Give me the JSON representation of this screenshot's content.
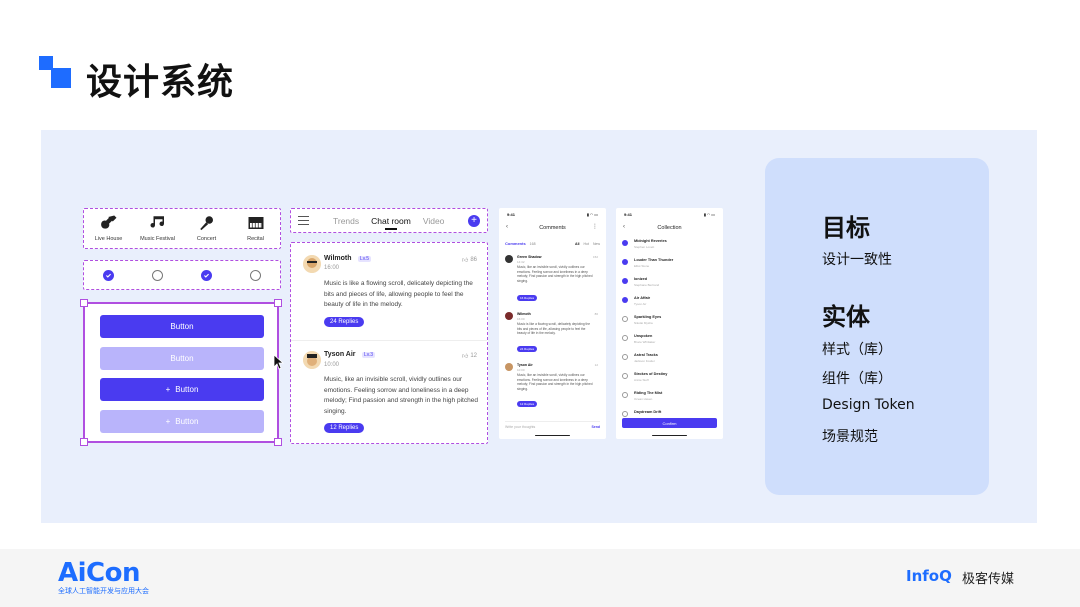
{
  "header": {
    "title": "设计系统"
  },
  "icon_nav": {
    "items": [
      {
        "label": "Live House",
        "icon": "guitar-icon"
      },
      {
        "label": "Music Festival",
        "icon": "music-note-icon"
      },
      {
        "label": "Concert",
        "icon": "microphone-icon"
      },
      {
        "label": "Recital",
        "icon": "piano-icon"
      }
    ]
  },
  "checkbox_row": {
    "states": [
      true,
      false,
      true,
      false
    ]
  },
  "buttons": {
    "primary_label": "Button",
    "disabled_label": "Button",
    "primary_icon_label": "Button",
    "disabled_icon_label": "Button",
    "plus_glyph": "+"
  },
  "tabs_bar": {
    "tabs": [
      "Trends",
      "Chat room",
      "Video"
    ],
    "active_tab": "Chat room",
    "plus": "+"
  },
  "comments": [
    {
      "name": "Wilmoth",
      "level": "Lv.5",
      "time": "16:00",
      "likes": "86",
      "text": "Music is like a flowing scroll, delicately depicting the bits and pieces of life, allowing people to feel the beauty of life in the melody.",
      "replies": "24 Replies"
    },
    {
      "name": "Tyson Air",
      "level": "Lv.3",
      "time": "10:00",
      "likes": "12",
      "text": "Music, like an invisible scroll, vividly outlines our emotions. Feeling sorrow and loneliness in a deep melody; Find passion and strength in the high pitched singing.",
      "replies": "12 Replies"
    }
  ],
  "phone_comments": {
    "status_time": "9:41",
    "title": "Comments",
    "tabs": [
      "Comments",
      "168",
      "All",
      "Hot",
      "New"
    ],
    "items": [
      {
        "name": "Green Shadow",
        "level": "Lv.6",
        "sub": "14:32",
        "text": "Music, like an invisible scroll, vividly outlines our emotions. Feeling sorrow and loneliness in a deep melody; Find passion and strength in the high pitched singing.",
        "replies": "16 Replies",
        "likes": "152"
      },
      {
        "name": "Wilmoth",
        "level": "Lv.5",
        "sub": "16:00",
        "text": "Music is like a flowing scroll, delicately depicting the bits and pieces of life, allowing people to feel the beauty of life in the melody.",
        "replies": "24 Replies",
        "likes": "86"
      },
      {
        "name": "Tyson Air",
        "level": "Lv.3",
        "sub": "10:00",
        "text": "Music, like an invisible scroll, vividly outlines our emotions. Feeling sorrow and loneliness in a deep melody; Find passion and strength in the high pitched singing.",
        "replies": "12 Replies",
        "likes": "12"
      }
    ],
    "input_placeholder": "Write your thoughts",
    "send": "Send"
  },
  "phone_collection": {
    "status_time": "9:41",
    "title": "Collection",
    "items": [
      {
        "title": "Midnight Reveries",
        "sub": "Stephen Lovett",
        "checked": true
      },
      {
        "title": "Louder Than Thunder",
        "sub": "Elliot Stone",
        "checked": true
      },
      {
        "title": "Ionized",
        "sub": "Stephane Bertrand",
        "checked": true
      },
      {
        "title": "Air Affair",
        "sub": "Tyson Air",
        "checked": true
      },
      {
        "title": "Sparkling Eyes",
        "sub": "Nikolai Mysha",
        "checked": false
      },
      {
        "title": "Unspoken",
        "sub": "Bruce Whittaker",
        "checked": false
      },
      {
        "title": "Astral Tracks",
        "sub": "Jackson Fowler",
        "checked": false
      },
      {
        "title": "Strokes of Destiny",
        "sub": "Annie Stoff",
        "checked": false
      },
      {
        "title": "Riding The Mist",
        "sub": "Ocean Haven",
        "checked": false
      },
      {
        "title": "Daydream Drift",
        "sub": "",
        "checked": false
      }
    ],
    "confirm": "Confirm"
  },
  "goals": {
    "h1": "目标",
    "t1": "设计一致性",
    "h2": "实体",
    "items": [
      "样式（库）",
      "组件（库）",
      "Design Token",
      "场景规范"
    ]
  },
  "footer": {
    "aicon": "AiCon",
    "aicon_sub": "全球人工智能开发与应用大会",
    "infoq": "InfoQ",
    "infoq_cn": "极客传媒"
  },
  "colors": {
    "accent": "#4a3bf0",
    "brand_blue": "#1d6dff",
    "selection": "#b04fe0",
    "panel_bg": "#e9effc",
    "card_bg": "#cfdefc"
  }
}
